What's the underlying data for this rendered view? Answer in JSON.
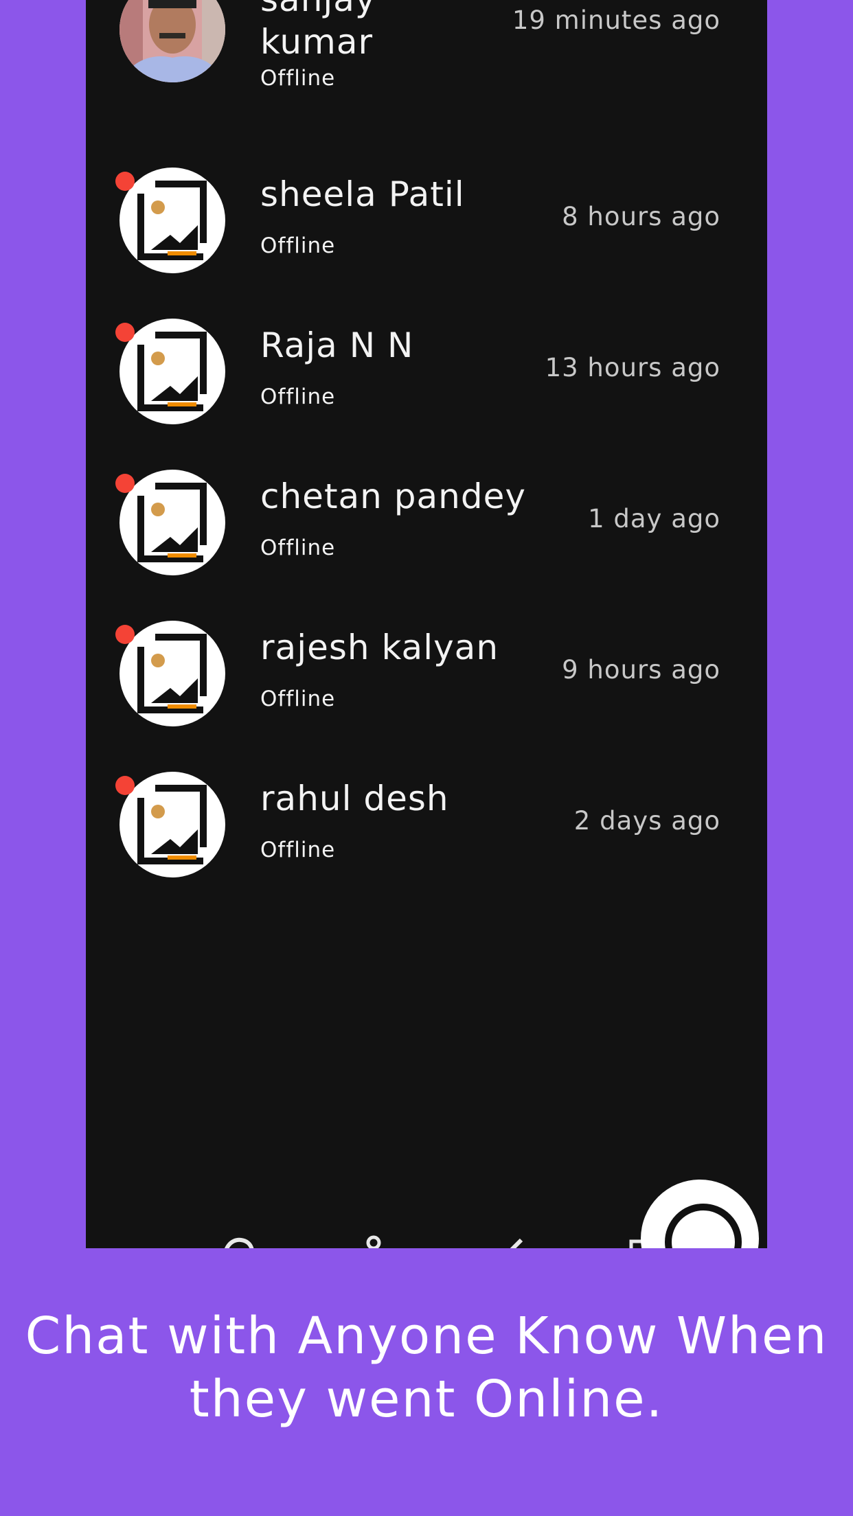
{
  "contacts": [
    {
      "name": "sanjay kumar",
      "status": "Offline",
      "last_seen": "19 minutes ago",
      "avatar_icon": "person-photo-icon"
    },
    {
      "name": "sheela Patil",
      "status": "Offline",
      "last_seen": "8 hours ago",
      "avatar_icon": "image-placeholder-icon"
    },
    {
      "name": "Raja N N",
      "status": "Offline",
      "last_seen": "13 hours ago",
      "avatar_icon": "image-placeholder-icon"
    },
    {
      "name": "chetan pandey",
      "status": "Offline",
      "last_seen": "1 day ago",
      "avatar_icon": "image-placeholder-icon"
    },
    {
      "name": "rajesh kalyan",
      "status": "Offline",
      "last_seen": "9 hours ago",
      "avatar_icon": "image-placeholder-icon"
    },
    {
      "name": "rahul desh",
      "status": "Offline",
      "last_seen": "2 days ago",
      "avatar_icon": "image-placeholder-icon"
    }
  ],
  "caption": "Chat with Anyone Know When they went Online.",
  "nav_icons": [
    "chat-icon",
    "person-icon",
    "edit-icon",
    "gallery-icon"
  ],
  "fab_icon": "chat-bubble-icon",
  "colors": {
    "page_background": "#8c56ea",
    "phone_background": "#121212",
    "status_dot": "#f44336",
    "text_primary": "#f3f3f3",
    "text_secondary": "#c8c8c8"
  }
}
